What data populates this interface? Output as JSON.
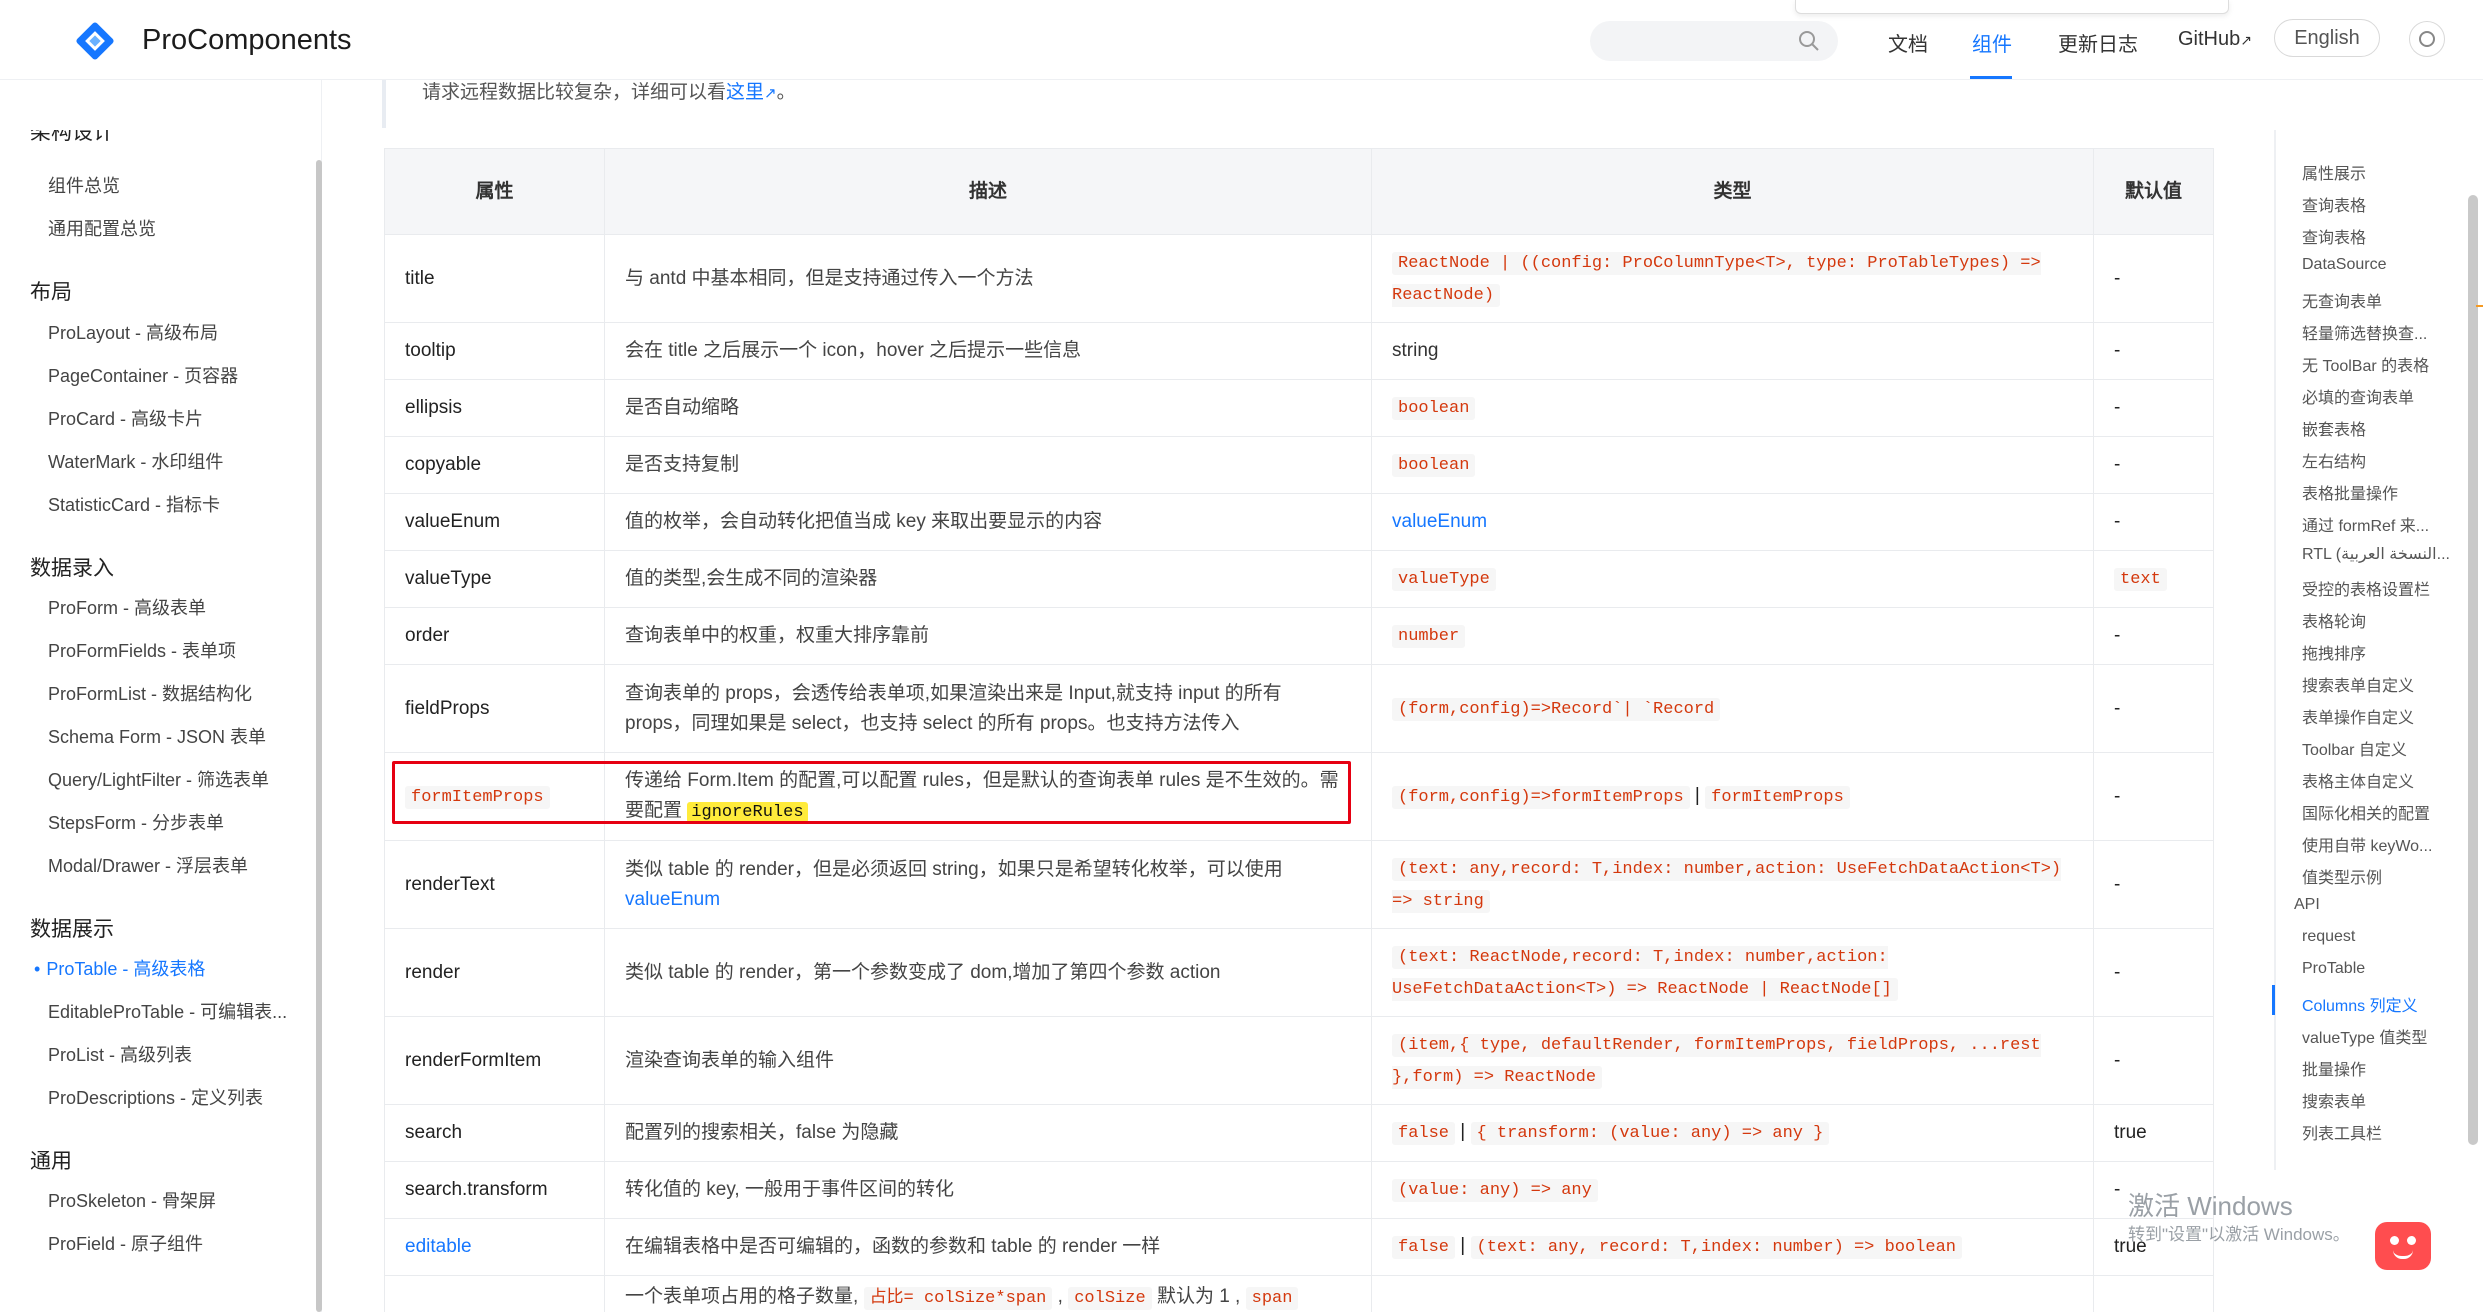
{
  "header": {
    "brand": "ProComponents",
    "nav": [
      "文档",
      "组件",
      "更新日志",
      "GitHub"
    ],
    "active_nav": "组件",
    "lang_button": "English",
    "search_placeholder": "",
    "accent": "#1677ff"
  },
  "sidebar": {
    "partial_heading": "架构设计",
    "groups": [
      {
        "title": "",
        "items": [
          "组件总览",
          "通用配置总览"
        ]
      },
      {
        "title": "布局",
        "items": [
          "ProLayout - 高级布局",
          "PageContainer - 页容器",
          "ProCard - 高级卡片",
          "WaterMark - 水印组件",
          "StatisticCard - 指标卡"
        ]
      },
      {
        "title": "数据录入",
        "items": [
          "ProForm - 高级表单",
          "ProFormFields - 表单项",
          "ProFormList - 数据结构化",
          "Schema Form - JSON 表单",
          "Query/LightFilter - 筛选表单",
          "StepsForm - 分步表单",
          "Modal/Drawer - 浮层表单"
        ]
      },
      {
        "title": "数据展示",
        "items": [
          "ProTable - 高级表格",
          "EditableProTable - 可编辑表...",
          "ProList - 高级列表",
          "ProDescriptions - 定义列表"
        ]
      },
      {
        "title": "通用",
        "items": [
          "ProSkeleton - 骨架屏",
          "ProField - 原子组件"
        ]
      }
    ],
    "active_item": "ProTable - 高级表格"
  },
  "note": {
    "text": "请求远程数据比较复杂，详细可以看",
    "link": "这里",
    "tail": "。"
  },
  "table": {
    "headers": [
      "属性",
      "描述",
      "类型",
      "默认值"
    ],
    "rows": [
      {
        "name": "title",
        "desc": "与 antd 中基本相同，但是支持通过传入一个方法",
        "type": "ReactNode | ((config: ProColumnType<T>, type: ProTableTypes) => ReactNode)",
        "default": "-"
      },
      {
        "name": "tooltip",
        "desc": "会在 title 之后展示一个 icon，hover 之后提示一些信息",
        "type": "string",
        "default": "-"
      },
      {
        "name": "ellipsis",
        "desc": "是否自动缩略",
        "type": "boolean",
        "default": "-"
      },
      {
        "name": "copyable",
        "desc": "是否支持复制",
        "type": "boolean",
        "default": "-"
      },
      {
        "name": "valueEnum",
        "desc": "值的枚举，会自动转化把值当成 key 来取出要显示的内容",
        "type": "valueEnum",
        "default": "-"
      },
      {
        "name": "valueType",
        "desc": "值的类型,会生成不同的渲染器",
        "type": "valueType",
        "default": "text"
      },
      {
        "name": "order",
        "desc": "查询表单中的权重，权重大排序靠前",
        "type": "number",
        "default": "-"
      },
      {
        "name": "fieldProps",
        "desc": "查询表单的 props，会透传给表单项,如果渲染出来是 Input,就支持 input 的所有 props，同理如果是 select，也支持 select 的所有 props。也支持方法传入",
        "type": "(form,config)=>Record`| `Record",
        "default": "-"
      },
      {
        "name": "formItemProps",
        "desc": "传递给 Form.Item 的配置,可以配置 rules，但是默认的查询表单 rules 是不生效的。需要配置",
        "desc_code": "ignoreRules",
        "type": "(form,config)=>formItemProps",
        "type2": "formItemProps",
        "default": "-"
      },
      {
        "name": "renderText",
        "desc": "类似 table 的 render，但是必须返回 string，如果只是希望转化枚举，可以使用",
        "desc_link": "valueEnum",
        "type": "(text: any,record: T,index: number,action: UseFetchDataAction<T>) => string",
        "default": "-"
      },
      {
        "name": "render",
        "desc": "类似 table 的 render，第一个参数变成了 dom,增加了第四个参数 action",
        "type": "(text: ReactNode,record: T,index: number,action: UseFetchDataAction<T>) => ReactNode | ReactNode[]",
        "default": "-"
      },
      {
        "name": "renderFormItem",
        "desc": "渲染查询表单的输入组件",
        "type": "(item,{ type, defaultRender, formItemProps, fieldProps, ...rest },form) => ReactNode",
        "default": "-"
      },
      {
        "name": "search",
        "desc": "配置列的搜索相关，false 为隐藏",
        "type": "false",
        "type2": "{ transform: (value: any) => any }",
        "default": "true"
      },
      {
        "name": "search.transform",
        "desc": "转化值的 key, 一般用于事件区间的转化",
        "type": "(value: any) => any",
        "default": "-"
      },
      {
        "name": "editable",
        "desc": "在编辑表格中是否可编辑的，函数的参数和 table 的 render 一样",
        "type": "false",
        "type2": "(text: any, record: T,index: number) => boolean",
        "default": "true"
      },
      {
        "name": "",
        "desc": "一个表单项占用的格子数量,",
        "desc_code": "占比= colSize*span",
        "desc_code2": "colSize",
        "desc_tail": "默认为 1 ,",
        "desc_code3": "span",
        "type": "",
        "default": ""
      }
    ]
  },
  "toc": {
    "items": [
      "属性展示",
      "查询表格",
      "查询表格",
      "DataSource",
      "无查询表单",
      "轻量筛选替换查...",
      "无 ToolBar 的表格",
      "必填的查询表单",
      "嵌套表格",
      "左右结构",
      "表格批量操作",
      "通过 formRef 来...",
      "RTL (النسخة العربية...",
      "受控的表格设置栏",
      "表格轮询",
      "拖拽排序",
      "搜索表单自定义",
      "表单操作自定义",
      "Toolbar 自定义",
      "表格主体自定义",
      "国际化相关的配置",
      "使用自带 keyWo...",
      "值类型示例",
      "API",
      "request",
      "ProTable",
      "Columns 列定义",
      "valueType 值类型",
      "批量操作",
      "搜索表单",
      "列表工具栏"
    ],
    "active": "Columns 列定义"
  },
  "watermark": {
    "line1": "激活 Windows",
    "line2": "转到\"设置\"以激活 Windows。"
  }
}
